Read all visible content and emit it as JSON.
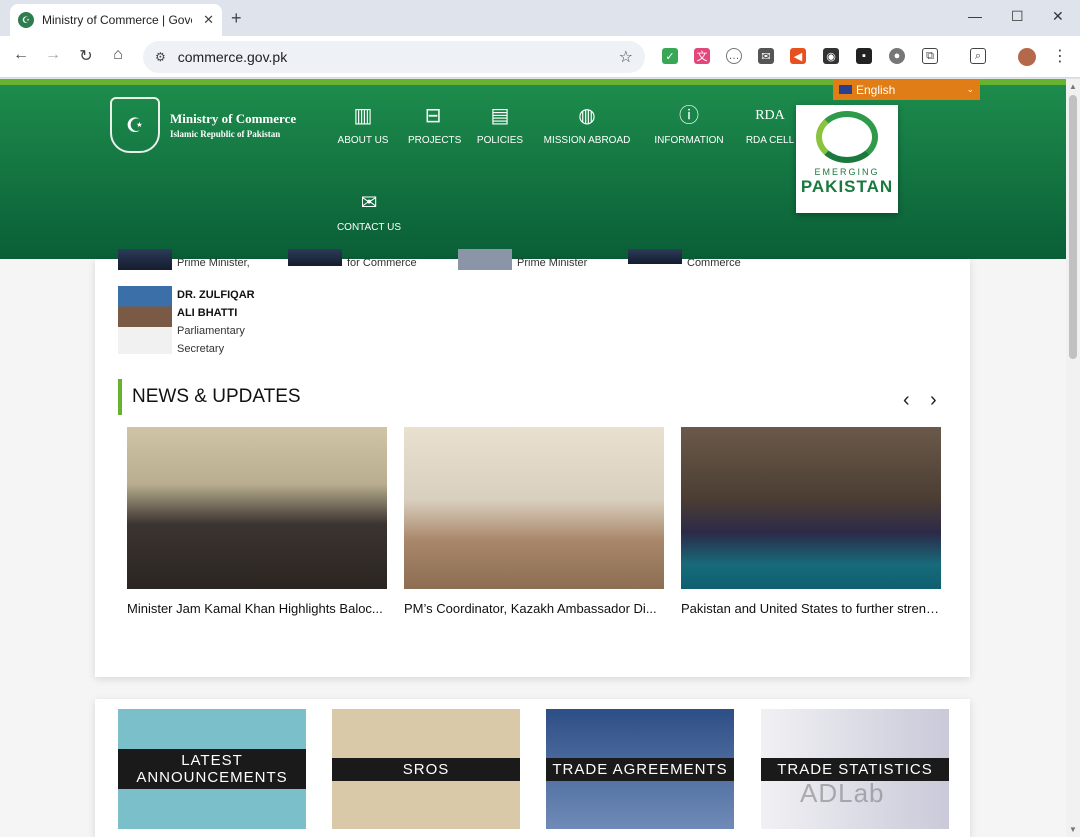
{
  "browser": {
    "tab_title": "Ministry of Commerce | Gove",
    "url": "commerce.gov.pk",
    "new_tab": "+",
    "tab_close": "✕",
    "window_controls": [
      "—",
      "☐",
      "✕"
    ]
  },
  "header": {
    "logo_line1": "Ministry of Commerce",
    "logo_line2": "Islamic Republic of Pakistan",
    "menu": [
      {
        "label": "ABOUT US",
        "icon": "building-icon"
      },
      {
        "label": "PROJECTS",
        "icon": "briefcase-icon"
      },
      {
        "label": "POLICIES",
        "icon": "document-icon"
      },
      {
        "label": "MISSION ABROAD",
        "icon": "globe-icon"
      },
      {
        "label": "INFORMATION",
        "icon": "info-icon"
      },
      {
        "label": "RDA CELL",
        "icon": "rda-icon"
      },
      {
        "label": "CONTACT US",
        "icon": "envelope-icon"
      }
    ],
    "rda_text": "RDA",
    "emerging_line1": "EMERGING",
    "emerging_line2": "PAKISTAN",
    "language": "English"
  },
  "leaders": [
    {
      "title": "Prime Minister,"
    },
    {
      "title": "for Commerce"
    },
    {
      "title": "Prime Minister"
    },
    {
      "title": "Commerce"
    },
    {
      "name_line1": "DR. ZULFIQAR",
      "name_line2": "ALI BHATTI",
      "title_line1": "Parliamentary",
      "title_line2": "Secretary"
    }
  ],
  "news": {
    "heading": "NEWS & UPDATES",
    "prev": "‹",
    "next": "›",
    "items": [
      {
        "caption": "Minister Jam Kamal Khan Highlights Baloc..."
      },
      {
        "caption": "PM’s Coordinator, Kazakh Ambassador Di..."
      },
      {
        "caption": "Pakistan and United States to further streng..."
      }
    ]
  },
  "tiles": [
    {
      "line1": "LATEST",
      "line2": "ANNOUNCEMENTS"
    },
    {
      "line1": "SROS"
    },
    {
      "line1": "TRADE AGREEMENTS"
    },
    {
      "line1": "TRADE STATISTICS"
    }
  ],
  "watermark": "ADLab",
  "colors": {
    "header_green": "#0a5e37",
    "accent_green": "#67b22f",
    "lang_orange": "#e07d16"
  }
}
